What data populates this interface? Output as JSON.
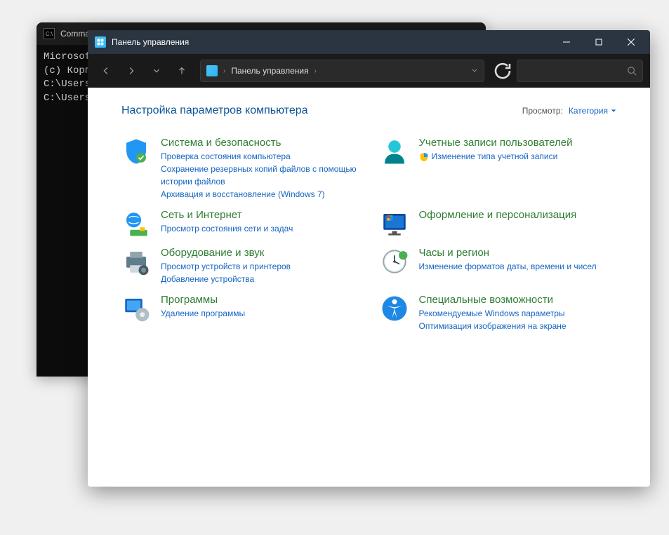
{
  "cmd": {
    "title": "Comman",
    "lines": [
      "Microsoft",
      "(c) Корпо",
      "",
      "C:\\Users\\",
      "",
      "C:\\Users\\"
    ]
  },
  "cp": {
    "title": "Панель управления",
    "breadcrumb": "Панель управления",
    "heading": "Настройка параметров компьютера",
    "view": {
      "label": "Просмотр:",
      "value": "Категория"
    },
    "cats": [
      {
        "title": "Система и безопасность",
        "links": [
          "Проверка состояния компьютера",
          "Сохранение резервных копий файлов с помощью истории файлов",
          "Архивация и восстановление (Windows 7)"
        ]
      },
      {
        "title": "Учетные записи пользователей",
        "links": [
          "Изменение типа учетной записи"
        ],
        "shield": [
          true
        ]
      },
      {
        "title": "Сеть и Интернет",
        "links": [
          "Просмотр состояния сети и задач"
        ]
      },
      {
        "title": "Оформление и персонализация",
        "links": []
      },
      {
        "title": "Оборудование и звук",
        "links": [
          "Просмотр устройств и принтеров",
          "Добавление устройства"
        ]
      },
      {
        "title": "Часы и регион",
        "links": [
          "Изменение форматов даты, времени и чисел"
        ]
      },
      {
        "title": "Программы",
        "links": [
          "Удаление программы"
        ]
      },
      {
        "title": "Специальные возможности",
        "links": [
          "Рекомендуемые Windows параметры",
          "Оптимизация изображения на экране"
        ]
      }
    ]
  }
}
